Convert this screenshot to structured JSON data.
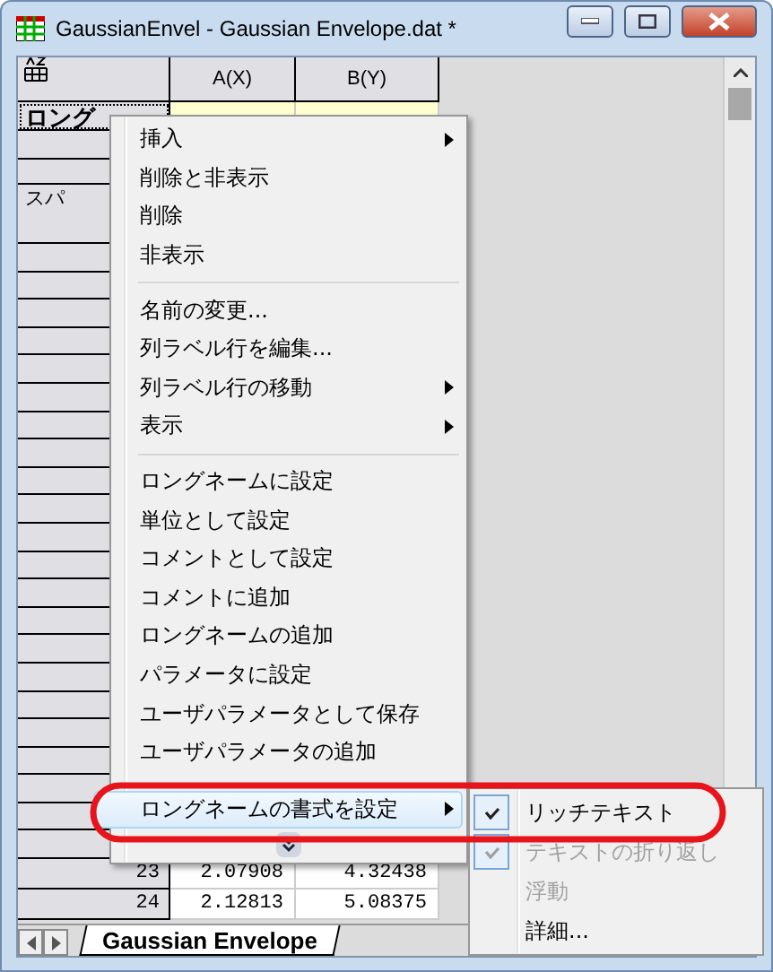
{
  "window": {
    "title": "GaussianEnvel - Gaussian Envelope.dat *"
  },
  "sheet": {
    "columns": [
      "A(X)",
      "B(Y)"
    ],
    "longname_label": "ロング",
    "sparkline_label": "スパ",
    "rows": [
      {
        "index": "23",
        "values": [
          "2.07908",
          "4.32438"
        ]
      },
      {
        "index": "24",
        "values": [
          "2.12813",
          "5.08375"
        ]
      }
    ]
  },
  "tabs": [
    {
      "label": "Gaussian Envelope",
      "selected": true
    }
  ],
  "context_menu": {
    "items": [
      {
        "kind": "item",
        "label": "挿入",
        "submenu": true,
        "selected": false
      },
      {
        "kind": "item",
        "label": "削除と非表示",
        "submenu": false,
        "selected": false
      },
      {
        "kind": "item",
        "label": "削除",
        "submenu": false,
        "selected": false
      },
      {
        "kind": "item",
        "label": "非表示",
        "submenu": false,
        "selected": false
      },
      {
        "kind": "separator"
      },
      {
        "kind": "item",
        "label": "名前の変更...",
        "submenu": false,
        "selected": false
      },
      {
        "kind": "item",
        "label": "列ラベル行を編集...",
        "submenu": false,
        "selected": false
      },
      {
        "kind": "item",
        "label": "列ラベル行の移動",
        "submenu": true,
        "selected": false
      },
      {
        "kind": "item",
        "label": "表示",
        "submenu": true,
        "selected": false
      },
      {
        "kind": "separator"
      },
      {
        "kind": "item",
        "label": "ロングネームに設定",
        "submenu": false,
        "selected": false
      },
      {
        "kind": "item",
        "label": "単位として設定",
        "submenu": false,
        "selected": false
      },
      {
        "kind": "item",
        "label": "コメントとして設定",
        "submenu": false,
        "selected": false
      },
      {
        "kind": "item",
        "label": "コメントに追加",
        "submenu": false,
        "selected": false
      },
      {
        "kind": "item",
        "label": "ロングネームの追加",
        "submenu": false,
        "selected": false
      },
      {
        "kind": "item",
        "label": "パラメータに設定",
        "submenu": false,
        "selected": false
      },
      {
        "kind": "item",
        "label": "ユーザパラメータとして保存",
        "submenu": false,
        "selected": false
      },
      {
        "kind": "item",
        "label": "ユーザパラメータの追加",
        "submenu": false,
        "selected": false
      },
      {
        "kind": "gap"
      },
      {
        "kind": "item",
        "label": "ロングネームの書式を設定",
        "submenu": true,
        "selected": true
      },
      {
        "kind": "more"
      }
    ]
  },
  "submenu": {
    "items": [
      {
        "label": "リッチテキスト",
        "checked": true,
        "disabled": false
      },
      {
        "label": "テキストの折り返し",
        "checked": true,
        "disabled": true
      },
      {
        "label": "浮動",
        "checked": false,
        "disabled": true
      },
      {
        "label": "詳細...",
        "checked": false,
        "disabled": false
      }
    ]
  },
  "highlight_ellipse": true
}
